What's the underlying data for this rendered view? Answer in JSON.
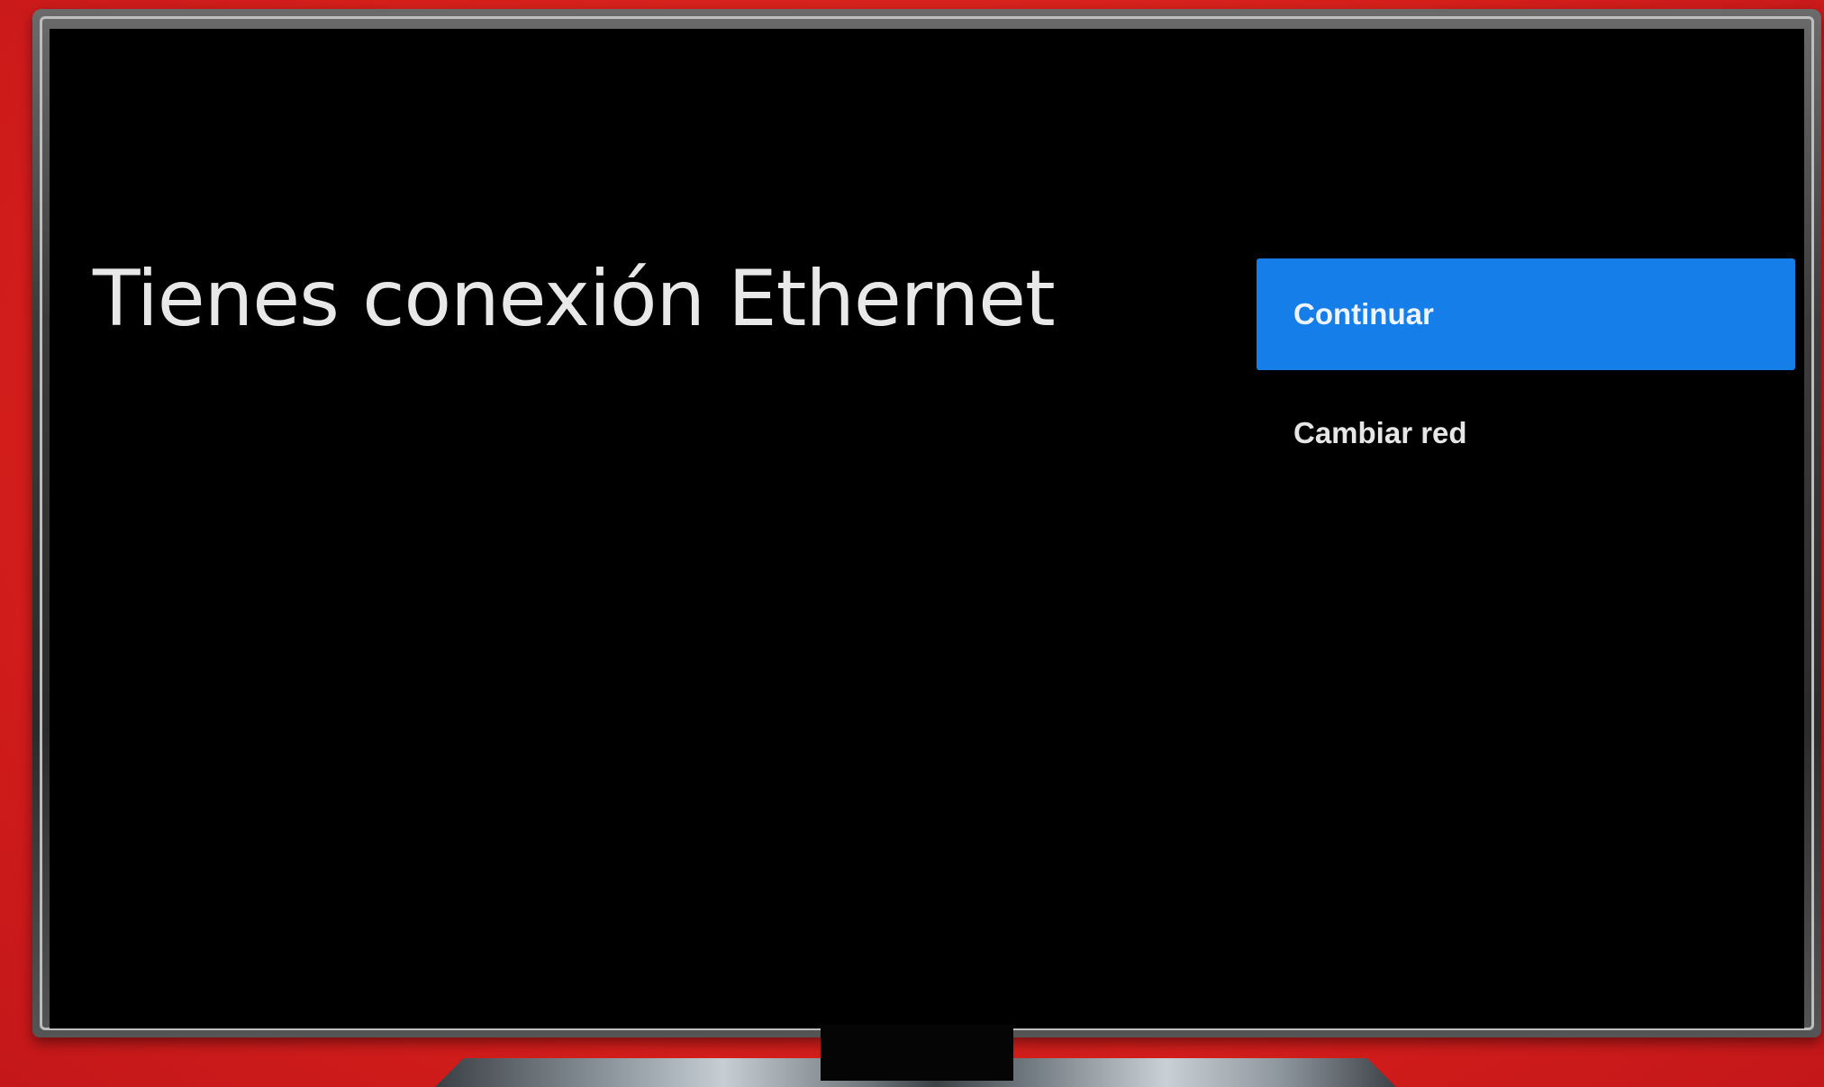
{
  "screen": {
    "title": "Tienes conexión Ethernet",
    "actions": {
      "primary_label": "Continuar",
      "secondary_label": "Cambiar red"
    }
  },
  "colors": {
    "background": "#d61f1b",
    "screen": "#000000",
    "primary_button": "#157ee8",
    "title_text": "#e8e8e8"
  }
}
